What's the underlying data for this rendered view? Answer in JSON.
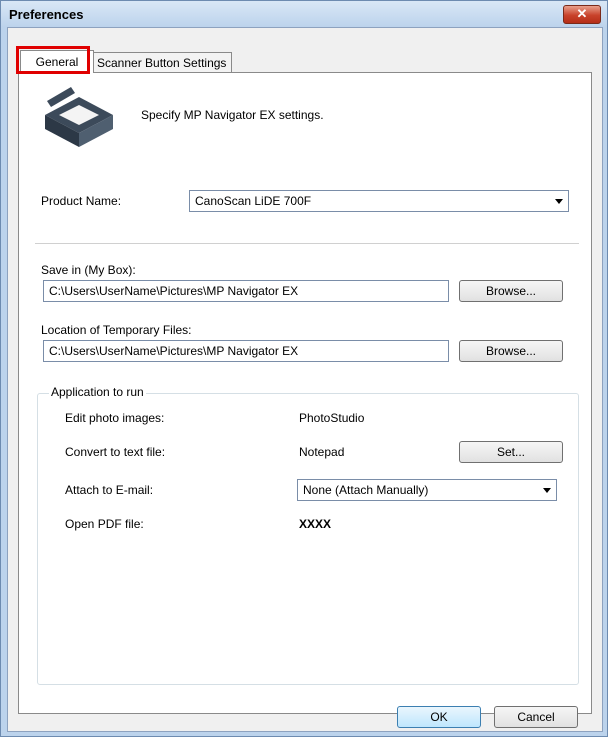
{
  "window": {
    "title": "Preferences",
    "close_glyph": "✕"
  },
  "tabs": [
    {
      "label": "General"
    },
    {
      "label": "Scanner Button Settings"
    }
  ],
  "header": {
    "description": "Specify MP Navigator EX settings.",
    "icon": "scanner-icon"
  },
  "product": {
    "label": "Product Name:",
    "value": "CanoScan LiDE 700F"
  },
  "save_in": {
    "label": "Save in (My Box):",
    "value": "C:\\Users\\UserName\\Pictures\\MP Navigator EX",
    "browse_label": "Browse..."
  },
  "temp_files": {
    "label": "Location of Temporary Files:",
    "value": "C:\\Users\\UserName\\Pictures\\MP Navigator EX",
    "browse_label": "Browse..."
  },
  "apps": {
    "group_label": "Application to run",
    "rows": [
      {
        "label": "Edit photo images:",
        "value": "PhotoStudio"
      },
      {
        "label": "Convert to text file:",
        "value": "Notepad",
        "button": "Set..."
      },
      {
        "label": "Attach to E-mail:",
        "value": "None (Attach Manually)"
      },
      {
        "label": "Open PDF file:",
        "value": "XXXX"
      }
    ]
  },
  "footer": {
    "ok_label": "OK",
    "cancel_label": "Cancel"
  },
  "colors": {
    "highlight": "#e00000",
    "close_button": "#c8422a"
  }
}
